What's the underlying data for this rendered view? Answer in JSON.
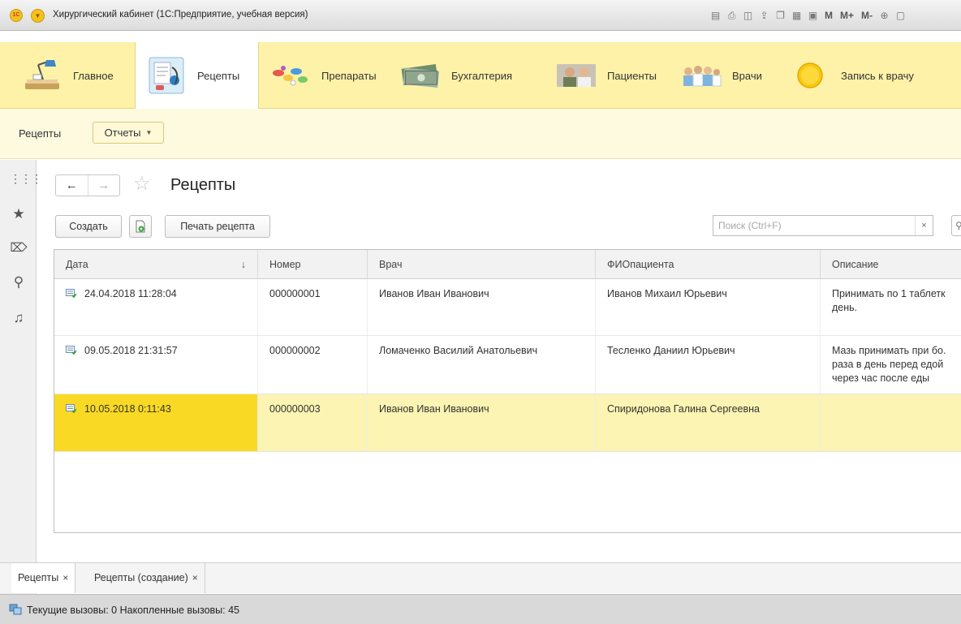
{
  "window": {
    "logo_text": "1С",
    "title": "Хирургический кабинет (1С:Предприятие, учебная версия)",
    "toolbar_m_labels": [
      "M",
      "M+",
      "M-"
    ]
  },
  "sections": [
    {
      "label": "Главное",
      "icon": "desk-lamp-icon"
    },
    {
      "label": "Рецепты",
      "icon": "prescription-icon"
    },
    {
      "label": "Препараты",
      "icon": "pills-icon"
    },
    {
      "label": "Бухгалтерия",
      "icon": "money-icon"
    },
    {
      "label": "Пациенты",
      "icon": "patients-icon"
    },
    {
      "label": "Врачи",
      "icon": "doctors-icon"
    },
    {
      "label": "Запись к врачу",
      "icon": "sun-circle-icon"
    }
  ],
  "active_section": "Рецепты",
  "subbar": {
    "link": "Рецепты",
    "reports": "Отчеты"
  },
  "form": {
    "title": "Рецепты",
    "create_label": "Создать",
    "print_label": "Печать рецепта",
    "search_placeholder": "Поиск (Ctrl+F)",
    "search_clear": "×"
  },
  "table": {
    "columns": [
      "Дата",
      "Номер",
      "Врач",
      "ФИОпациента",
      "Описание"
    ],
    "sort_indicator": "↓",
    "rows": [
      {
        "date": "24.04.2018 11:28:04",
        "number": "000000001",
        "doctor": "Иванов Иван Иванович",
        "patient": "Иванов Михаил Юрьевич",
        "description": "Принимать по 1 таблетк день."
      },
      {
        "date": "09.05.2018 21:31:57",
        "number": "000000002",
        "doctor": "Ломаченко Василий Анатольевич",
        "patient": "Тесленко Даниил Юрьевич",
        "description": "Мазь принимать при бо. раза в день перед едой через час после еды"
      },
      {
        "date": "10.05.2018 0:11:43",
        "number": "000000003",
        "doctor": "Иванов Иван Иванович",
        "patient": "Спиридонова Галина Сергеевна",
        "description": ""
      }
    ],
    "selected_row": 2
  },
  "tabs": [
    {
      "label": "Рецепты",
      "close": "×"
    },
    {
      "label": "Рецепты (создание)",
      "close": "×"
    }
  ],
  "status": {
    "text": "Текущие вызовы: 0   Накопленные вызовы: 45"
  },
  "colors": {
    "sections_bg": "#fdf2a8",
    "selected_cell": "#f9d923",
    "selected_row": "#fbf4b2"
  }
}
